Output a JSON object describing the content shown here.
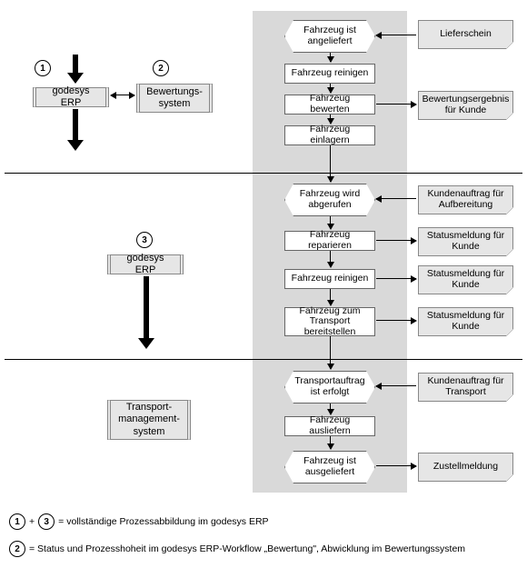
{
  "systems": {
    "erp1": "godesys ERP",
    "bewertung": "Bewertungs-\nsystem",
    "erp2": "godesys ERP",
    "transport": "Transport-\nmanagement-\nsystem"
  },
  "steps": {
    "s1": "Fahrzeug ist angeliefert",
    "s2": "Fahrzeug reinigen",
    "s3": "Fahrzeug bewerten",
    "s4": "Fahrzeug einlagern",
    "s5": "Fahrzeug wird abgerufen",
    "s6": "Fahrzeug reparieren",
    "s7": "Fahrzeug reinigen",
    "s8": "Fahrzeug zum Transport bereitstellen",
    "s9": "Transportauftrag ist erfolgt",
    "s10": "Fahrzeug ausliefern",
    "s11": "Fahrzeug ist ausgeliefert"
  },
  "notes": {
    "n1": "Lieferschein",
    "n3": "Bewertungsergebnis für Kunde",
    "n5": "Kundenauftrag für Aufbereitung",
    "n6": "Statusmeldung für Kunde",
    "n7": "Statusmeldung für Kunde",
    "n8": "Statusmeldung für Kunde",
    "n9": "Kundenauftrag für Transport",
    "n11": "Zustellmeldung"
  },
  "numbers": {
    "one": "1",
    "two": "2",
    "three": "3"
  },
  "legend": {
    "l1_pre": "+",
    "l1": "= vollständige Prozessabbildung im godesys ERP",
    "l2": "= Status und Prozesshoheit im godesys ERP-Workflow „Bewertung\", Abwicklung im Bewertungssystem"
  }
}
